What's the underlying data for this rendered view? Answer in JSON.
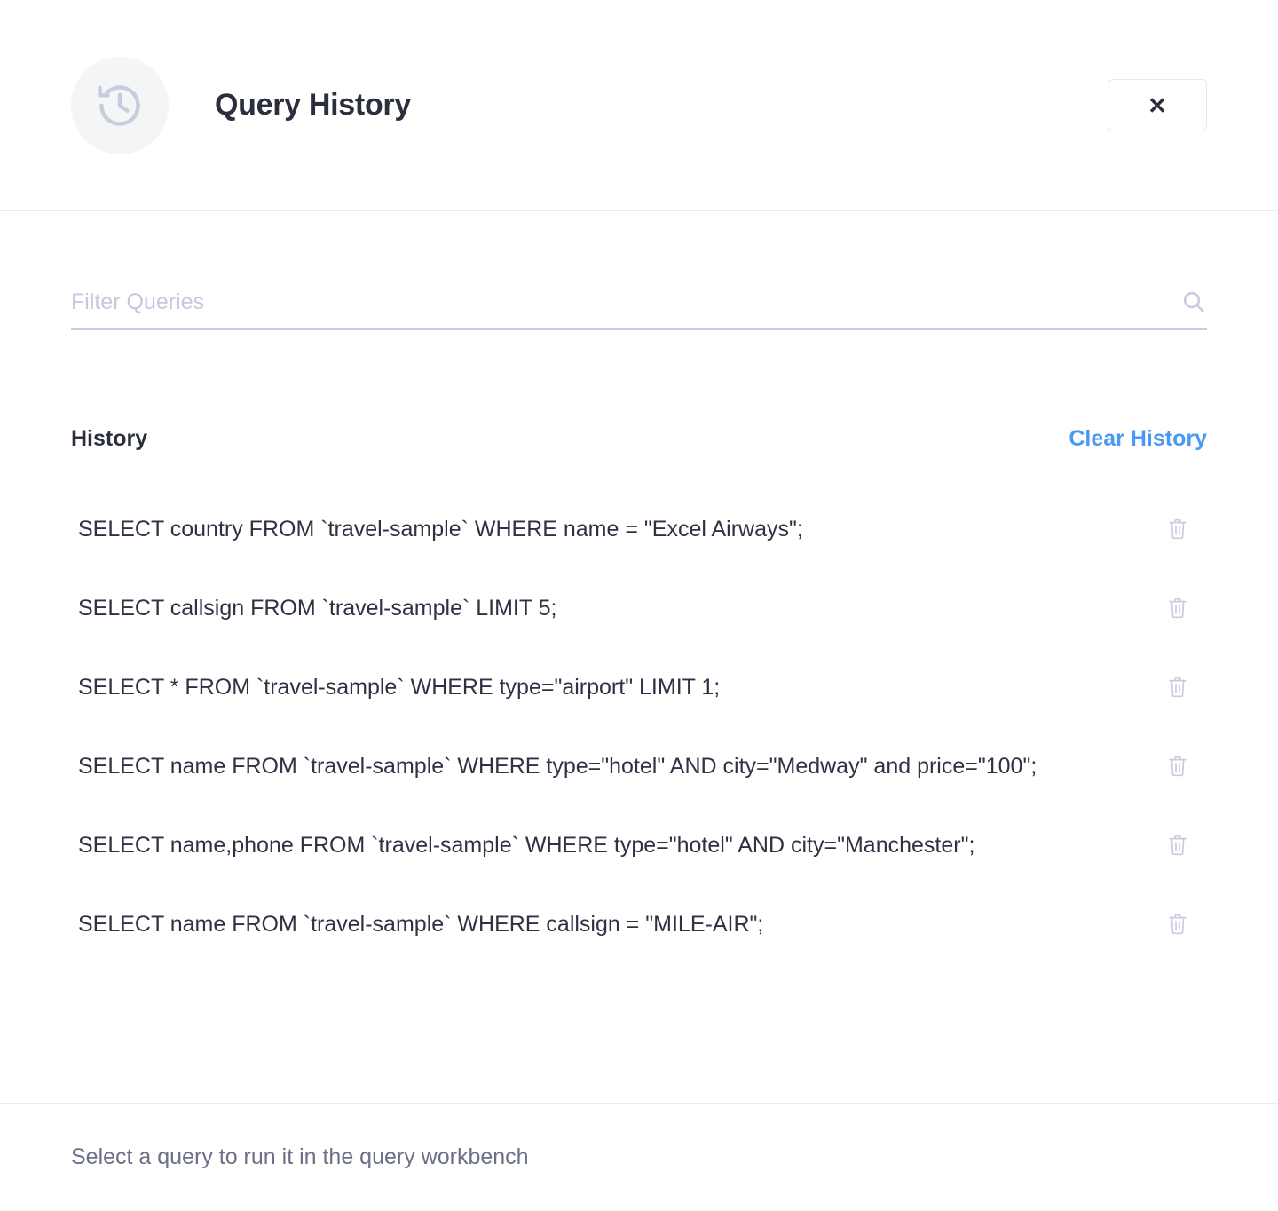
{
  "header": {
    "title": "Query History",
    "icon": "history-clock-icon",
    "close_label": "✕"
  },
  "search": {
    "placeholder": "Filter Queries",
    "value": "",
    "icon": "search-icon"
  },
  "history_section": {
    "label": "History",
    "clear_label": "Clear History",
    "row_icon": "trash-icon",
    "items": [
      {
        "query": "SELECT country FROM `travel-sample` WHERE name = \"Excel Airways\";"
      },
      {
        "query": "SELECT callsign FROM `travel-sample` LIMIT 5;"
      },
      {
        "query": "SELECT * FROM `travel-sample` WHERE type=\"airport\" LIMIT 1;"
      },
      {
        "query": "SELECT name FROM `travel-sample` WHERE type=\"hotel\" AND city=\"Medway\" and price=\"100\";"
      },
      {
        "query": "SELECT name,phone FROM `travel-sample` WHERE type=\"hotel\" AND city=\"Manchester\";"
      },
      {
        "query": "SELECT name FROM `travel-sample` WHERE callsign = \"MILE-AIR\";"
      }
    ]
  },
  "footer": {
    "hint": "Select a query to run it in the query workbench"
  },
  "colors": {
    "accent_blue": "#4a9af5",
    "text_dark": "#2e3243",
    "icon_muted": "#c9ccdf",
    "placeholder": "#c6c9de",
    "divider": "#e9eaf0",
    "avatar_bg": "#f4f5f7",
    "footer_text": "#6b6f87"
  }
}
